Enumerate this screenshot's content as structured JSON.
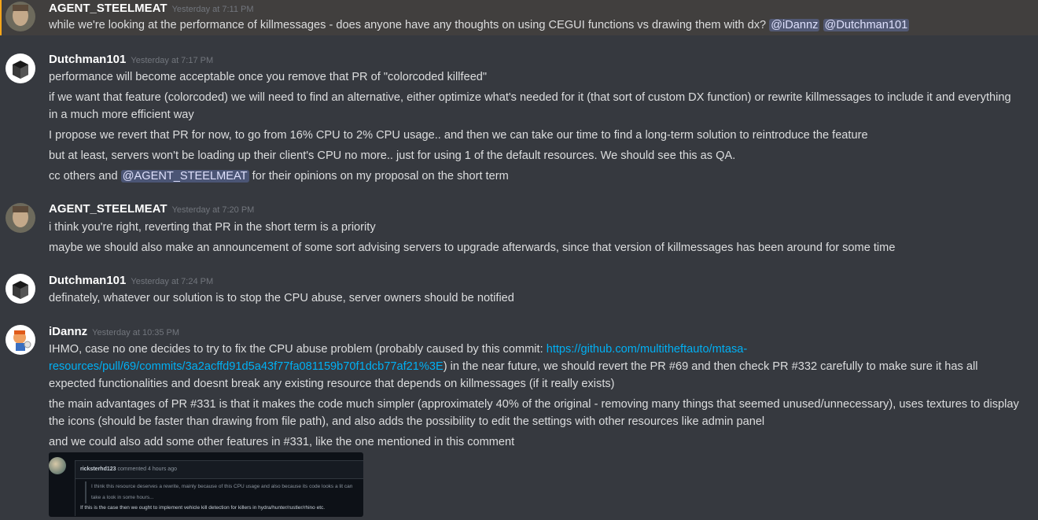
{
  "messages": [
    {
      "username": "AGENT_STEELMEAT",
      "timestamp": "Yesterday at 7:11 PM",
      "line1_text": "while we're looking at the performance of killmessages - does anyone have any thoughts on using CEGUI functions vs drawing them with dx?",
      "mention1": "@iDannz",
      "mention2": "@Dutchman101"
    },
    {
      "username": "Dutchman101",
      "timestamp": "Yesterday at 7:17 PM",
      "line1": "performance will become acceptable once you remove that PR of \"colorcoded killfeed\"",
      "line2": "if we want that feature (colorcoded) we will need to find an alternative, either optimize what's needed for it (that sort of custom DX function) or rewrite killmessages to include it and everything in a much more efficient way",
      "line3": "I propose we revert that PR for now, to go from 16% CPU to 2% CPU usage.. and then we can take our time to find a long-term solution to reintroduce the feature",
      "line4": "but at least, servers won't be loading up their client's CPU no more.. just for using 1 of the default resources. We should see this as QA.",
      "line5_pre": "cc others and",
      "line5_mention": "@AGENT_STEELMEAT",
      "line5_post": "for their opinions on my proposal on the short term"
    },
    {
      "username": "AGENT_STEELMEAT",
      "timestamp": "Yesterday at 7:20 PM",
      "line1": "i think you're right, reverting that PR in the short term is a priority",
      "line2": "maybe we should also make an announcement of some sort advising servers to upgrade afterwards, since that version of killmessages has been around for some time"
    },
    {
      "username": "Dutchman101",
      "timestamp": "Yesterday at 7:24 PM",
      "line1": "definately, whatever our solution is to stop the CPU abuse, server owners should be notified"
    },
    {
      "username": "iDannz",
      "timestamp": "Yesterday at 10:35 PM",
      "line1_pre": "IHMO, case no one decides to try to fix the CPU abuse problem (probably caused by this commit:",
      "line1_link": "https://github.com/multitheftauto/mtasa-resources/pull/69/commits/3a2acffd91d5a43f77fa081159b70f1dcb77af21%3E",
      "line1_post": ") in the near future, we should revert the PR #69 and then check PR #332 carefully to make sure it has all expected functionalities and doesnt break any existing resource that depends on killmessages (if it really exists)",
      "line2": "the main advantages of PR #331 is that it makes the code much simpler (approximately 40% of the original - removing many things that seemed unused/unnecessary), uses textures to display the icons (should be faster than drawing from file path), and also adds the possibility to edit the settings with other resources like admin panel",
      "line3": "and we could also add some other features in #331, like the one mentioned in this comment"
    }
  ],
  "embed": {
    "author": "ricksterhd123",
    "meta": "commented 4 hours ago",
    "quote": "I think this resource deserves a rewrite, mainly because of this CPU usage and also because its code looks a lit can take a look in some hours...",
    "text": "If this is the case then we ought to implement vehicle kill detection for killers in hydra/hunter/rustler/rhino etc."
  },
  "colors": {
    "background": "#36393f",
    "highlight_background": "#413f3e",
    "mention_text": "#dee0fc",
    "link": "#00b0f4",
    "timestamp": "#72767d"
  }
}
